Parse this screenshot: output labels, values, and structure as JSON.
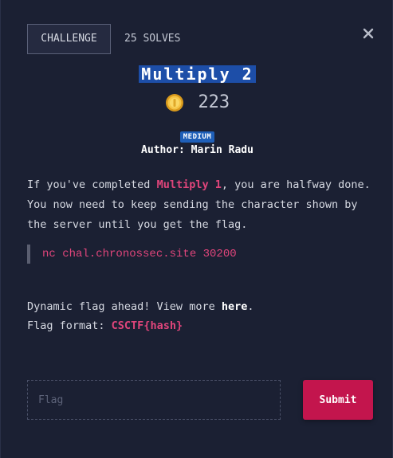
{
  "tabs": {
    "challenge_label": "CHALLENGE",
    "solves_label": "25 SOLVES"
  },
  "challenge": {
    "title": "Multiply 2",
    "points": "223",
    "difficulty": "MEDIUM",
    "author": "Author: Marin Radu"
  },
  "description": {
    "part1": "If you've completed ",
    "link_text": "Multiply 1",
    "part2": ", you are halfway done. You now need to keep sending the character shown by the server until you get the flag."
  },
  "connection": "nc chal.chronossec.site 30200",
  "info": {
    "dynamic_prefix": "Dynamic flag ahead! View more ",
    "here_link": "here",
    "dynamic_suffix": ".",
    "format_prefix": "Flag format: ",
    "format_value": "CSCTF{hash}"
  },
  "form": {
    "flag_placeholder": "Flag",
    "submit_label": "Submit"
  },
  "icons": {
    "close": "close-icon",
    "coin": "coin-icon"
  },
  "colors": {
    "background": "#1b2033",
    "accent_pink": "#e0457b",
    "title_highlight": "#1d4ea8",
    "submit_button": "#c3154d",
    "badge": "#1f5fb8"
  }
}
